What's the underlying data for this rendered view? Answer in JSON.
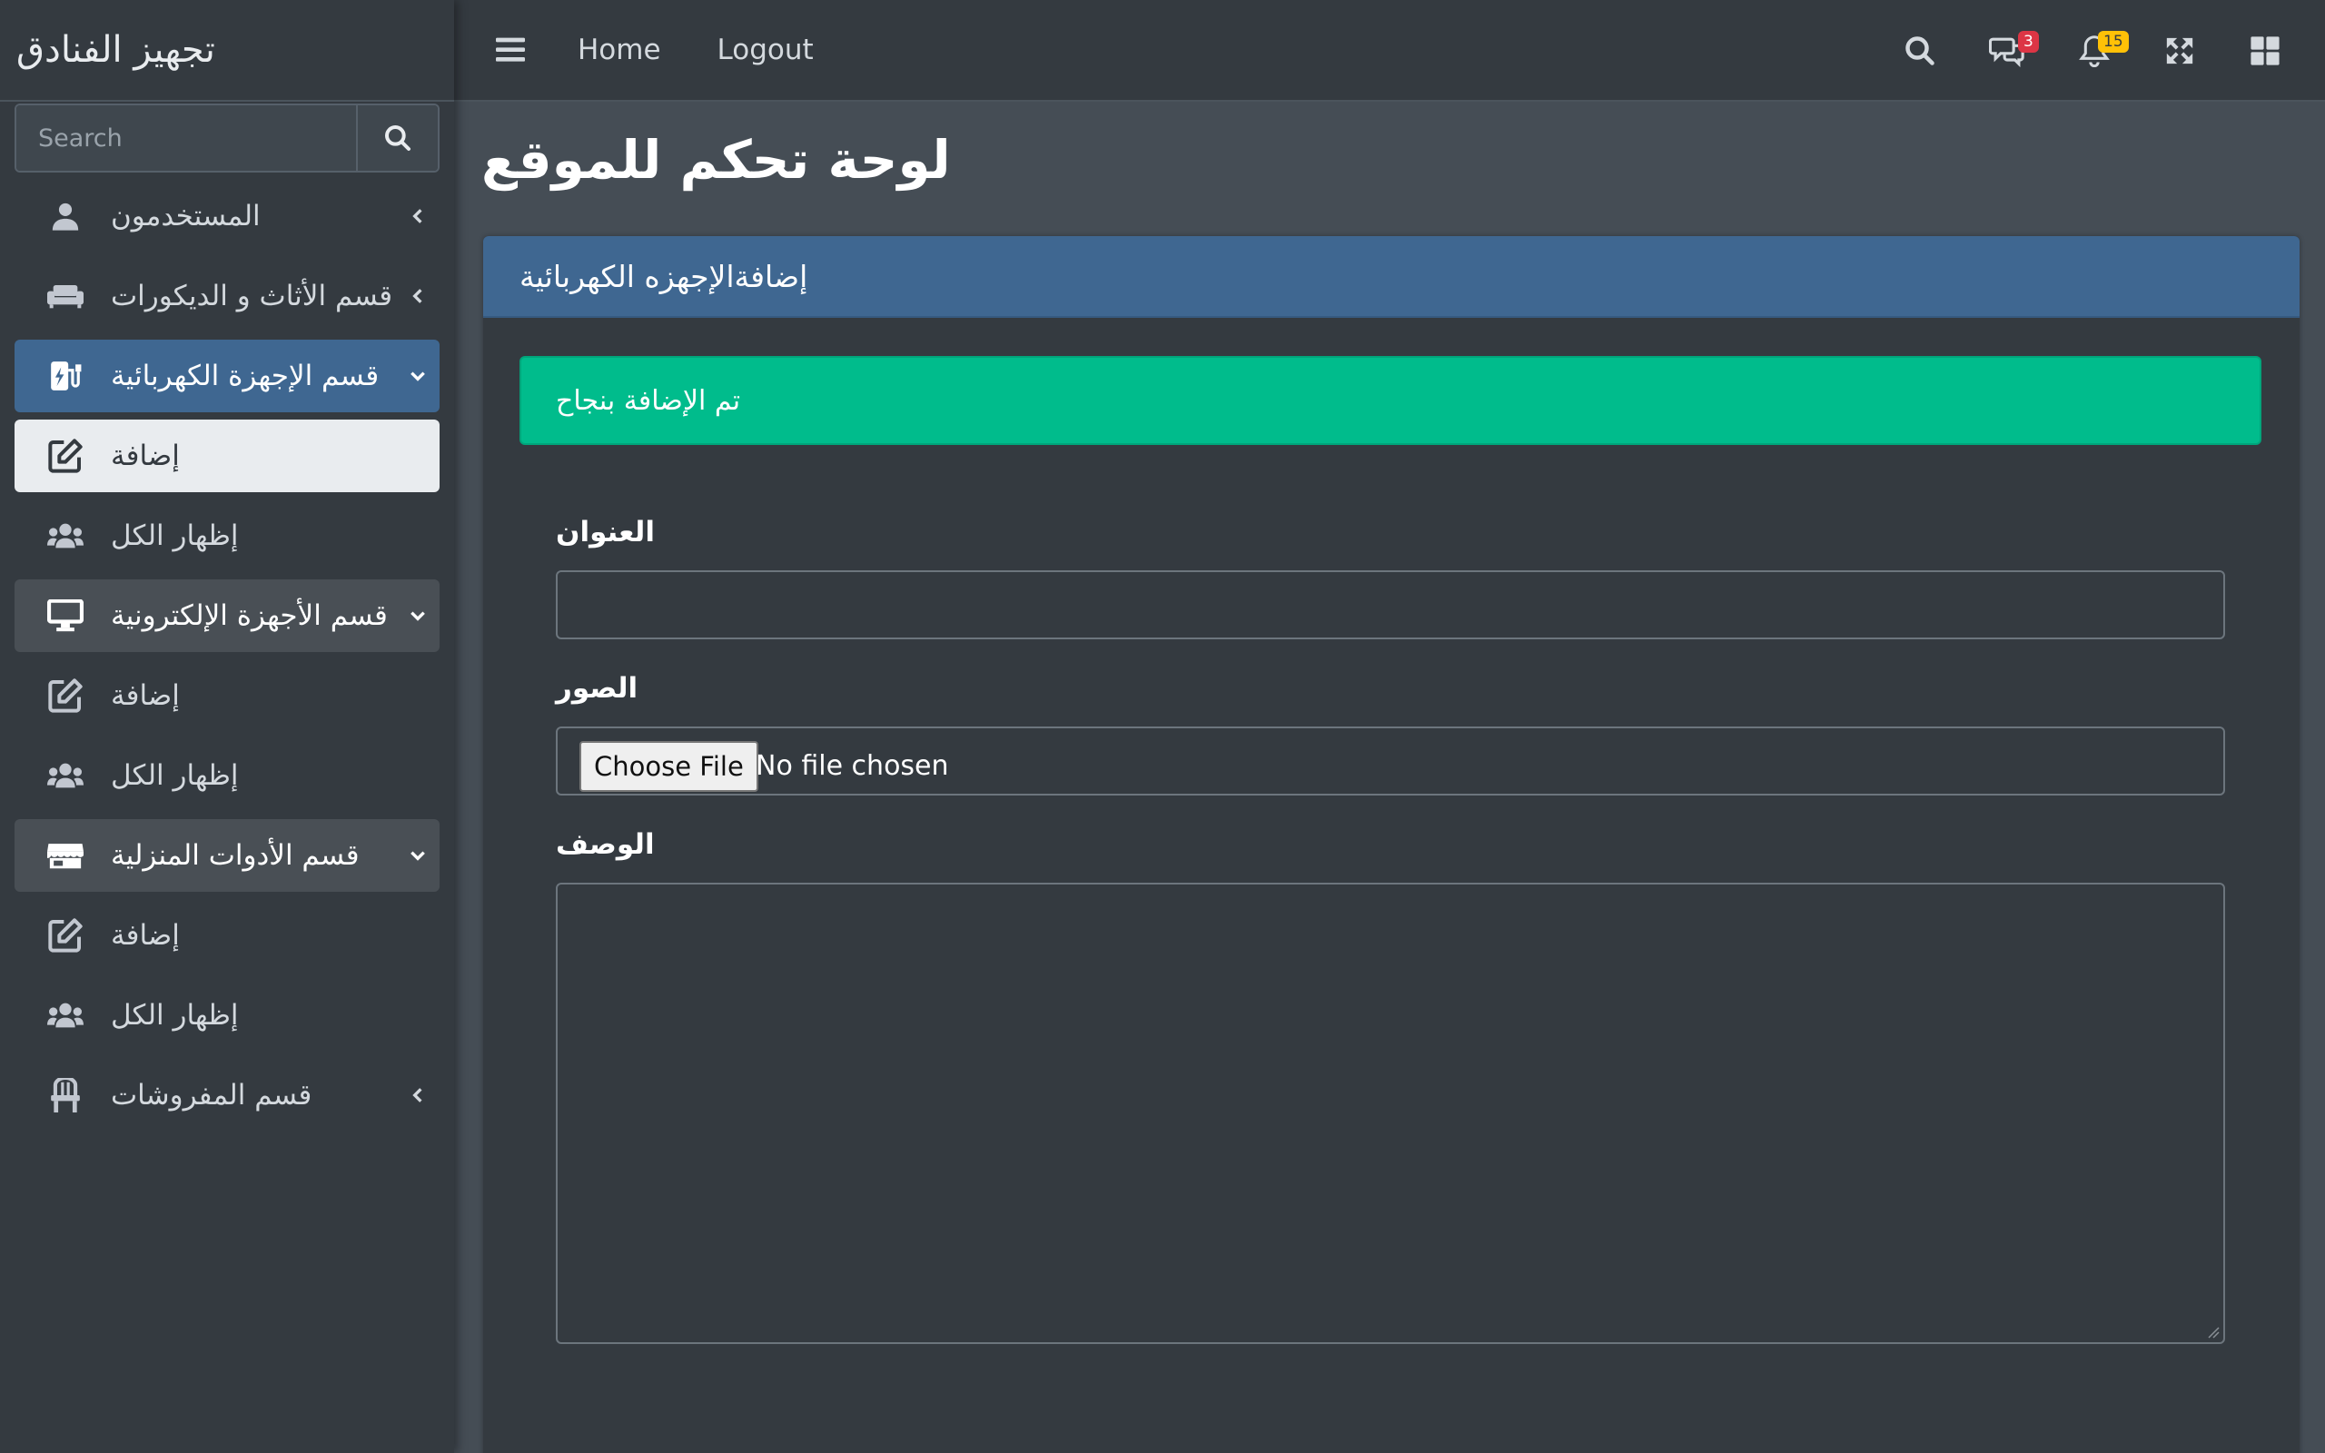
{
  "app": {
    "brand": "تجهيز الفنادق"
  },
  "search": {
    "placeholder": "Search"
  },
  "topbar": {
    "home": "Home",
    "logout": "Logout",
    "messages_badge": "3",
    "notifications_badge": "15"
  },
  "sidebar": {
    "items": [
      {
        "label": "المستخدمون",
        "icon": "user-icon"
      },
      {
        "label": "قسم الأثاث و الديكورات",
        "icon": "couch-icon"
      },
      {
        "label": "قسم الإجهزة الكهربائية",
        "icon": "charging-station-icon"
      },
      {
        "label": "إضافة",
        "icon": "edit-icon"
      },
      {
        "label": "إظهار الكل",
        "icon": "users-icon"
      },
      {
        "label": "قسم الأجهزة الإلكترونية",
        "icon": "desktop-icon"
      },
      {
        "label": "إضافة",
        "icon": "edit-icon"
      },
      {
        "label": "إظهار الكل",
        "icon": "users-icon"
      },
      {
        "label": "قسم الأدوات المنزلية",
        "icon": "store-icon"
      },
      {
        "label": "إضافة",
        "icon": "edit-icon"
      },
      {
        "label": "إظهار الكل",
        "icon": "users-icon"
      },
      {
        "label": "قسم المفروشات",
        "icon": "chair-icon"
      }
    ]
  },
  "main": {
    "page_title": "لوحة تحكم للموقع",
    "card_title": "إضافةالإجهزه الكهربائية",
    "alert": "تم الإضافة بنجاح",
    "form": {
      "title_label": "العنوان",
      "title_value": "",
      "images_label": "الصور",
      "file_button": "Choose File",
      "file_status": "No file chosen",
      "description_label": "الوصف",
      "description_value": ""
    }
  },
  "colors": {
    "primary": "#3f6791",
    "success": "#00bc8c",
    "danger_badge": "#dc3545",
    "warning_badge": "#ffc107"
  }
}
